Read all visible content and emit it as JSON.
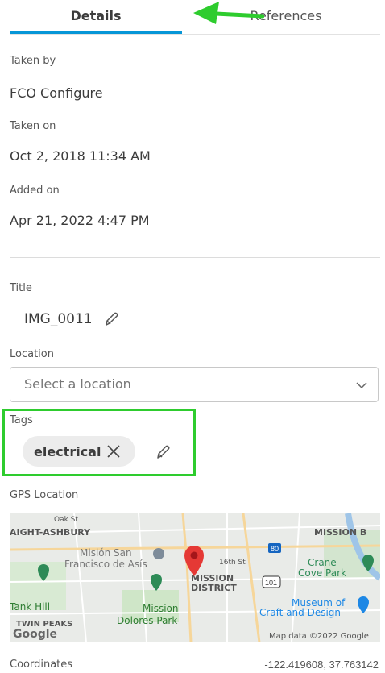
{
  "tabs": [
    {
      "label": "Details",
      "active": true
    },
    {
      "label": "References",
      "active": false
    }
  ],
  "details": {
    "taken_by_label": "Taken by",
    "taken_by_value": "FCO Configure",
    "taken_on_label": "Taken on",
    "taken_on_value": "Oct 2, 2018 11:34 AM",
    "added_on_label": "Added on",
    "added_on_value": "Apr 21, 2022 4:47 PM"
  },
  "title": {
    "label": "Title",
    "value": "IMG_0011",
    "edit_icon": "pencil-icon"
  },
  "location": {
    "label": "Location",
    "placeholder": "Select a location",
    "icon": "chevron-down-icon"
  },
  "tags": {
    "label": "Tags",
    "items": [
      "electrical"
    ],
    "remove_icon": "close-icon",
    "edit_icon": "pencil-icon"
  },
  "gps": {
    "label": "GPS Location",
    "map_labels": {
      "oak_st": "Oak St",
      "haight": "AIGHT-ASHBURY",
      "mission_b": "MISSION B",
      "mision_1": "Misión San",
      "mision_2": "Francisco de Asís",
      "st16": "16th St",
      "mission_district_1": "MISSION",
      "mission_district_2": "DISTRICT",
      "crane_1": "Crane",
      "crane_2": "Cove Park",
      "tank_hill": "Tank Hill",
      "mission_dolores_1": "Mission",
      "mission_dolores_2": "Dolores Park",
      "museum_1": "Museum of",
      "museum_2": "Craft and Design",
      "twin_peaks": "TWIN PEAKS",
      "hwy_80": "80",
      "hwy_101": "101",
      "google": "Google",
      "map_data": "Map data ©2022 Google"
    }
  },
  "coordinates": {
    "label": "Coordinates",
    "value": "-122.419608, 37.763142"
  },
  "colors": {
    "accent": "#0696d7",
    "highlight": "#2ecc2e",
    "pin": "#e53935"
  }
}
